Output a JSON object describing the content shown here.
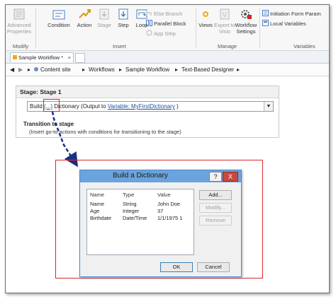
{
  "ribbon": {
    "groups": [
      {
        "label": "Modify",
        "buttons": [
          {
            "label": "Advanced Properties",
            "enabled": false
          }
        ]
      },
      {
        "label": "Insert",
        "buttons": [
          {
            "label": "Condition",
            "enabled": true
          },
          {
            "label": "Action",
            "enabled": true
          },
          {
            "label": "Stage",
            "enabled": false
          },
          {
            "label": "Step",
            "enabled": true
          },
          {
            "label": "Loop",
            "enabled": true
          }
        ],
        "small_buttons": [
          {
            "label": "Else Branch",
            "enabled": false
          },
          {
            "label": "Parallel Block",
            "enabled": true
          },
          {
            "label": "App Step",
            "enabled": false
          }
        ]
      },
      {
        "label": "Manage",
        "buttons": [
          {
            "label": "Views",
            "enabled": true
          },
          {
            "label": "Export to Visio",
            "enabled": false
          },
          {
            "label": "Workflow Settings",
            "enabled": true
          }
        ]
      },
      {
        "label": "Variables",
        "small_buttons": [
          {
            "label": "Initiation Form Param",
            "enabled": true
          },
          {
            "label": "Local Variables",
            "enabled": true
          }
        ]
      }
    ]
  },
  "tabs": [
    {
      "label": "Sample Workflow *"
    }
  ],
  "breadcrumb": [
    "Content site",
    "Workflows",
    "Sample Workflow",
    "Text-Based Designer"
  ],
  "stage": {
    "title": "Stage: Stage 1",
    "statement": {
      "prefix": "Build ",
      "placeholder": "(...)",
      "middle": " Dictionary (Output to ",
      "variable": "Variable: MyFirstDictionary",
      "suffix": " )"
    },
    "transition_title": "Transition to stage",
    "transition_desc": "(Insert go-to actions with conditions for transitioning to the stage)"
  },
  "dialog": {
    "title": "Build a Dictionary",
    "help": "?",
    "close": "X",
    "columns": [
      "Name",
      "Type",
      "Value"
    ],
    "rows": [
      {
        "name": "Name",
        "type": "String",
        "value": "John Doe"
      },
      {
        "name": "Age",
        "type": "Integer",
        "value": "37"
      },
      {
        "name": "Birthdate",
        "type": "Date/Time",
        "value": "1/1/1975 1"
      }
    ],
    "buttons": {
      "add": "Add...",
      "modify": "Modify...",
      "remove": "Remove",
      "ok": "OK",
      "cancel": "Cancel"
    }
  },
  "colors": {
    "highlight": "#d9262c",
    "dialog_title": "#6ba3dc",
    "arrow": "#1b2f82",
    "link": "#1f4e9b"
  }
}
